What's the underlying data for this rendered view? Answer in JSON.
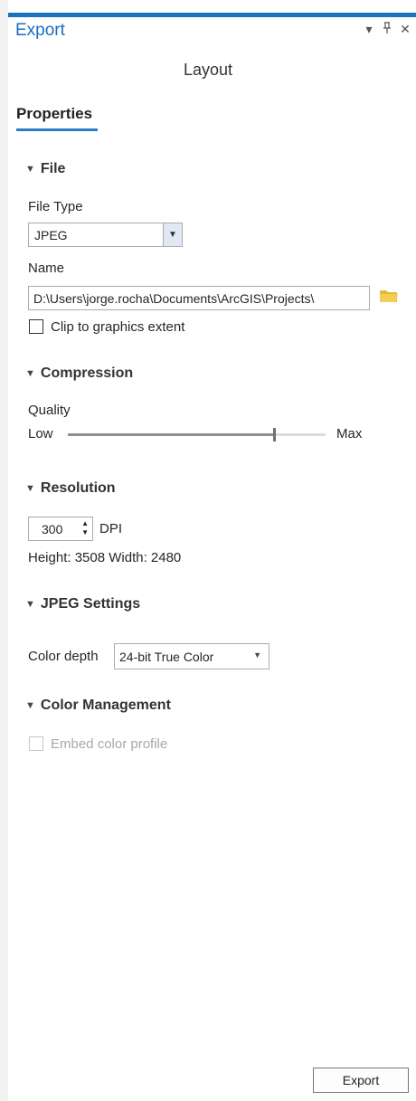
{
  "pane": {
    "title": "Export",
    "pin_glyph": "▾",
    "autohide_glyph": "⊥",
    "close_glyph": "✕"
  },
  "subtitle": "Layout",
  "tab": {
    "label": "Properties"
  },
  "file": {
    "heading": "File",
    "file_type_label": "File Type",
    "file_type_value": "JPEG",
    "name_label": "Name",
    "name_value": "D:\\Users\\jorge.rocha\\Documents\\ArcGIS\\Projects\\",
    "clip_label": "Clip to graphics extent",
    "clip_checked": false
  },
  "compression": {
    "heading": "Compression",
    "quality_label": "Quality",
    "low_label": "Low",
    "max_label": "Max",
    "quality_fraction": 0.8
  },
  "resolution": {
    "heading": "Resolution",
    "dpi_value": "300",
    "dpi_label": "DPI",
    "dimensions": "Height: 3508  Width: 2480"
  },
  "jpeg_settings": {
    "heading": "JPEG Settings",
    "color_depth_label": "Color depth",
    "color_depth_value": "24-bit True Color"
  },
  "color_management": {
    "heading": "Color Management",
    "embed_label": "Embed color profile",
    "embed_checked": false,
    "embed_enabled": false
  },
  "footer": {
    "export_label": "Export"
  },
  "colors": {
    "accent": "#1d72c0",
    "title": "#1b6ec2"
  }
}
